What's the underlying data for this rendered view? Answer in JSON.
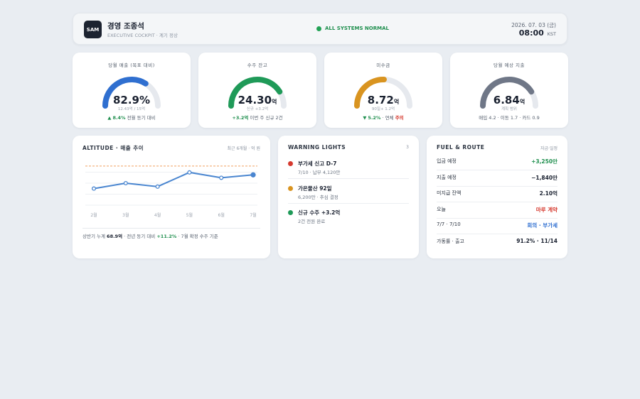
{
  "header": {
    "logo": "SAM",
    "name": "경영 조종석",
    "subtitle": "EXECUTIVE COCKPIT · 계기 정상",
    "status": "ALL SYSTEMS NORMAL",
    "status_color": "#22a255",
    "date": "2026. 07. 03 (금)",
    "time": "08:00",
    "tz": "KST"
  },
  "gauges": [
    {
      "title": "당월 매출 (목표 대비)",
      "value": "82.9%",
      "unit": "",
      "sub": "12.43억 / 15억",
      "foot_arrow": "▲",
      "foot_highlight": "8.4%",
      "foot_rest": " 전월 동기 대비",
      "fill": 0.829,
      "color": "#2f6fd0"
    },
    {
      "title": "수주 잔고",
      "value": "24.30",
      "unit": "억",
      "sub": "신규 +3.2억",
      "foot_arrow": "",
      "foot_highlight": "+3.2억",
      "foot_rest": " 이번 주 신규 2건",
      "fill": 1.0,
      "color": "#1f9a58"
    },
    {
      "title": "미수금",
      "value": "8.72",
      "unit": "억",
      "sub": "90일+ 1.2억",
      "foot_arrow": "▼",
      "foot_highlight": "5.2%",
      "foot_rest": " · 연체 ",
      "foot_warn": "주의",
      "fill": 0.62,
      "color": "#d99420"
    },
    {
      "title": "당월 예상 지출",
      "value": "6.84",
      "unit": "억",
      "sub": "계획 범위",
      "foot_arrow": "",
      "foot_highlight": "",
      "foot_rest": "매입 4.2 · 이동 1.7 · 카드 0.9",
      "fill": 1.0,
      "color": "#6f7787"
    }
  ],
  "altitude": {
    "title": "ALTITUDE · 매출 추이",
    "right": "최근 6개월 · 억 원",
    "foot_pre": "상반기 누계 ",
    "foot_bold": "68.9억",
    "foot_mid": " · 전년 동기 대비 ",
    "foot_green": "+11.2%",
    "foot_post": " · 7월 확정 수주 기준"
  },
  "chart_data": {
    "type": "line",
    "categories": [
      "2월",
      "3월",
      "4월",
      "5월",
      "6월",
      "7월"
    ],
    "series": [
      {
        "values": [
          10.4,
          11.5,
          10.8,
          13.7,
          12.6,
          13.2
        ]
      }
    ],
    "ylim": [
      7,
      16
    ],
    "target_line": 15,
    "line_color": "#4a86d0",
    "target_color": "#f0a060"
  },
  "warnings": {
    "title": "WARNING LIGHTS",
    "count": "3",
    "items": [
      {
        "title": "부가세 신고 D-7",
        "sub": "7/10 · 납부 4,120만",
        "color": "#d63a2f"
      },
      {
        "title": "가온물산 92일",
        "sub": "6,200만 · 추심 결정",
        "color": "#d99420"
      },
      {
        "title": "신규 수주 +3.2억",
        "sub": "2건 전원 완료",
        "color": "#1f9a58"
      }
    ]
  },
  "fuel": {
    "title": "FUEL & ROUTE",
    "right": "자금·일정",
    "rows": [
      {
        "label": "입금 예정",
        "value": "+3,250만",
        "tone": "green"
      },
      {
        "label": "지출 예정",
        "value": "−1,840만",
        "tone": ""
      },
      {
        "label": "미지급 잔액",
        "value": "2.10억",
        "tone": ""
      },
      {
        "label": "오늘",
        "value": "마루 계약",
        "tone": "red"
      },
      {
        "label": "7/7 · 7/10",
        "value": "회의 · 부가세",
        "tone": "blue"
      },
      {
        "label": "가동률 · 출고",
        "value": "91.2% · 11/14",
        "tone": ""
      }
    ]
  }
}
